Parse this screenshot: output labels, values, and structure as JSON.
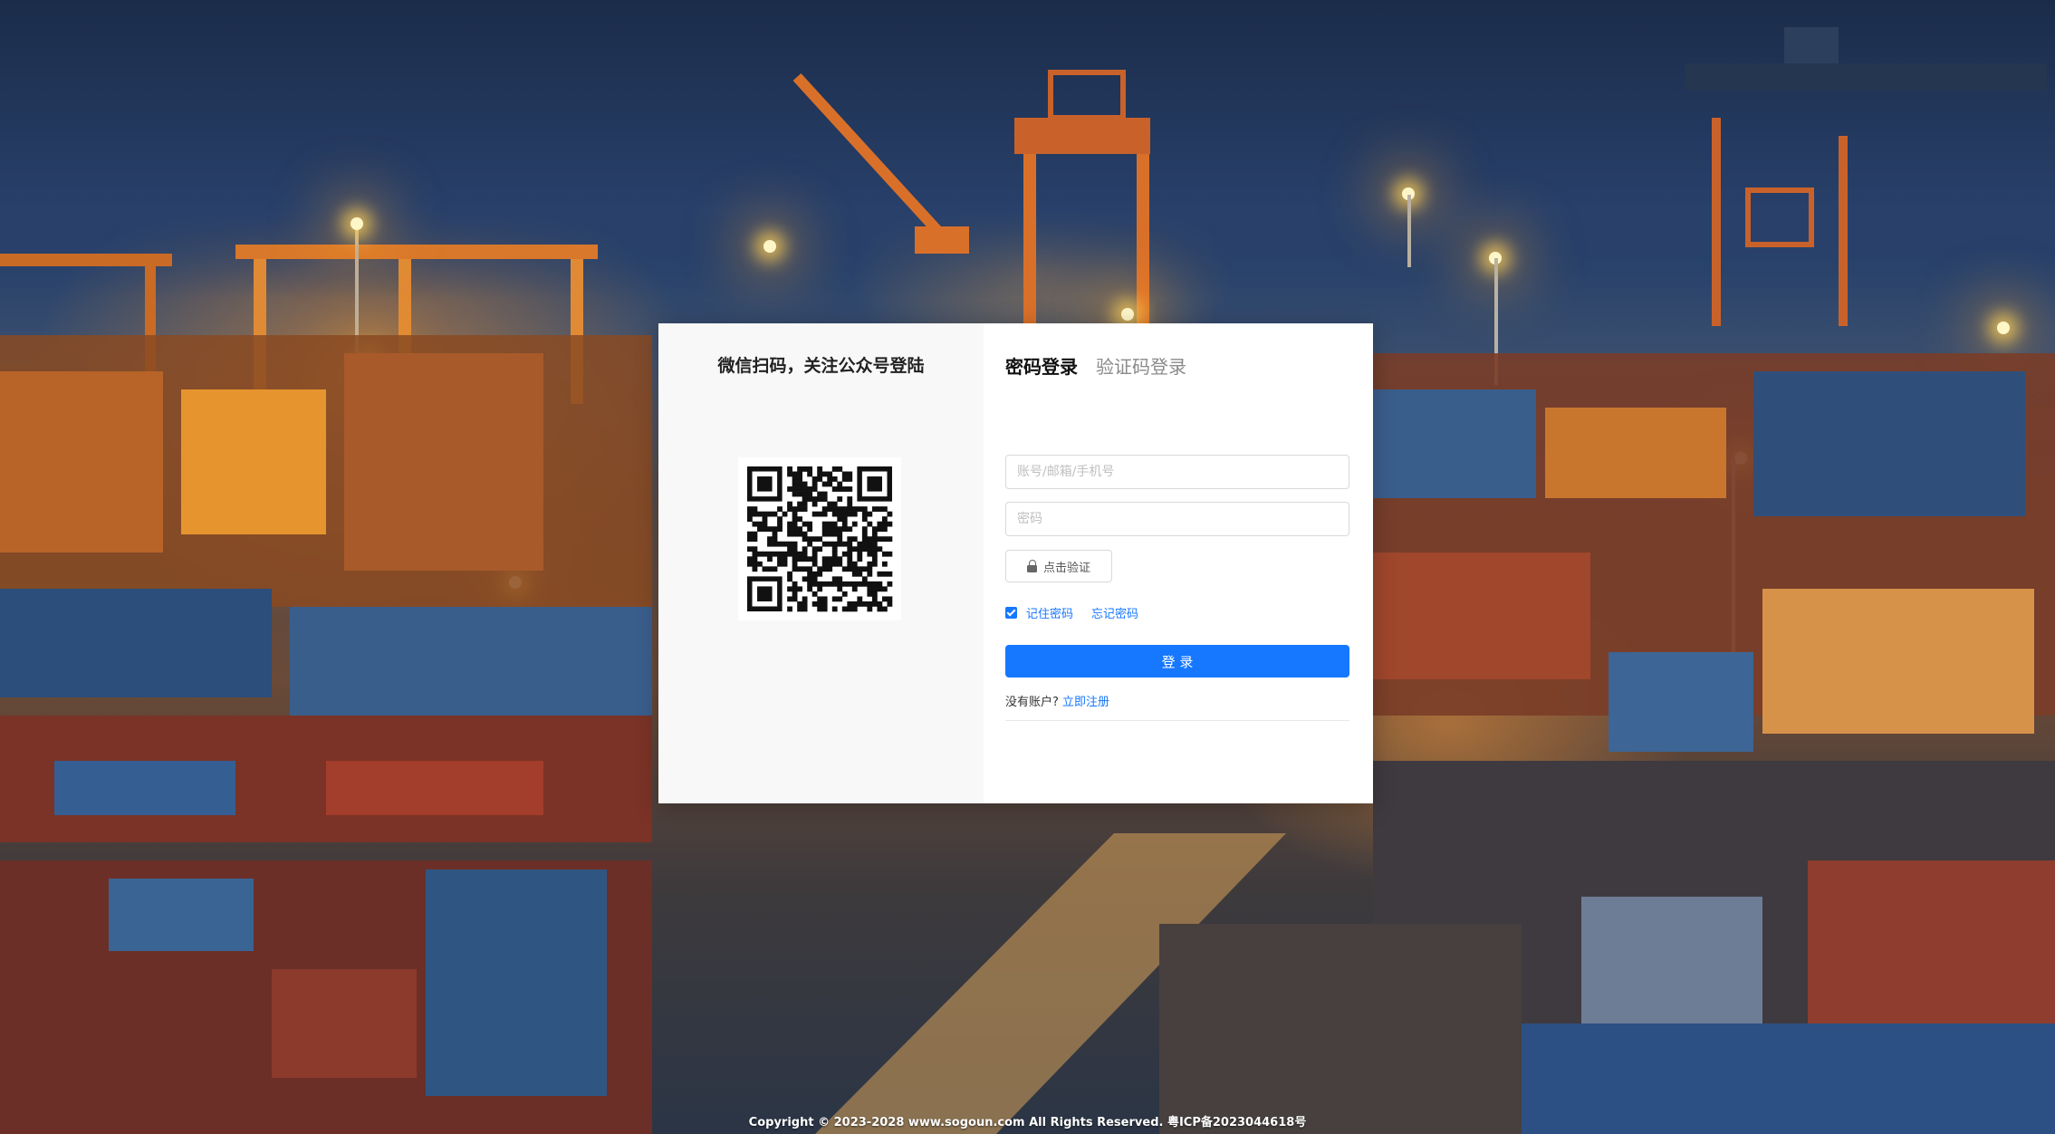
{
  "colors": {
    "accent": "#1677ff",
    "panel_left_bg": "#f8f8f8",
    "panel_bg": "#ffffff"
  },
  "qr_panel": {
    "title": "微信扫码，关注公众号登陆",
    "qr_icon": "qr-code-icon"
  },
  "tabs": [
    {
      "label": "密码登录",
      "active": true
    },
    {
      "label": "验证码登录",
      "active": false
    }
  ],
  "form": {
    "account_placeholder": "账号/邮箱/手机号",
    "password_placeholder": "密码",
    "verify_label": "点击验证",
    "verify_icon": "lock-icon",
    "remember_label": "记住密码",
    "remember_checked": true,
    "forgot_label": "忘记密码",
    "submit_label": "登 录",
    "no_account_text": "没有账户?",
    "register_label": "立即注册"
  },
  "footer": {
    "copyright": "Copyright © 2023-2028 www.sogoun.com All Rights Reserved. 粤ICP备2023044618号"
  }
}
